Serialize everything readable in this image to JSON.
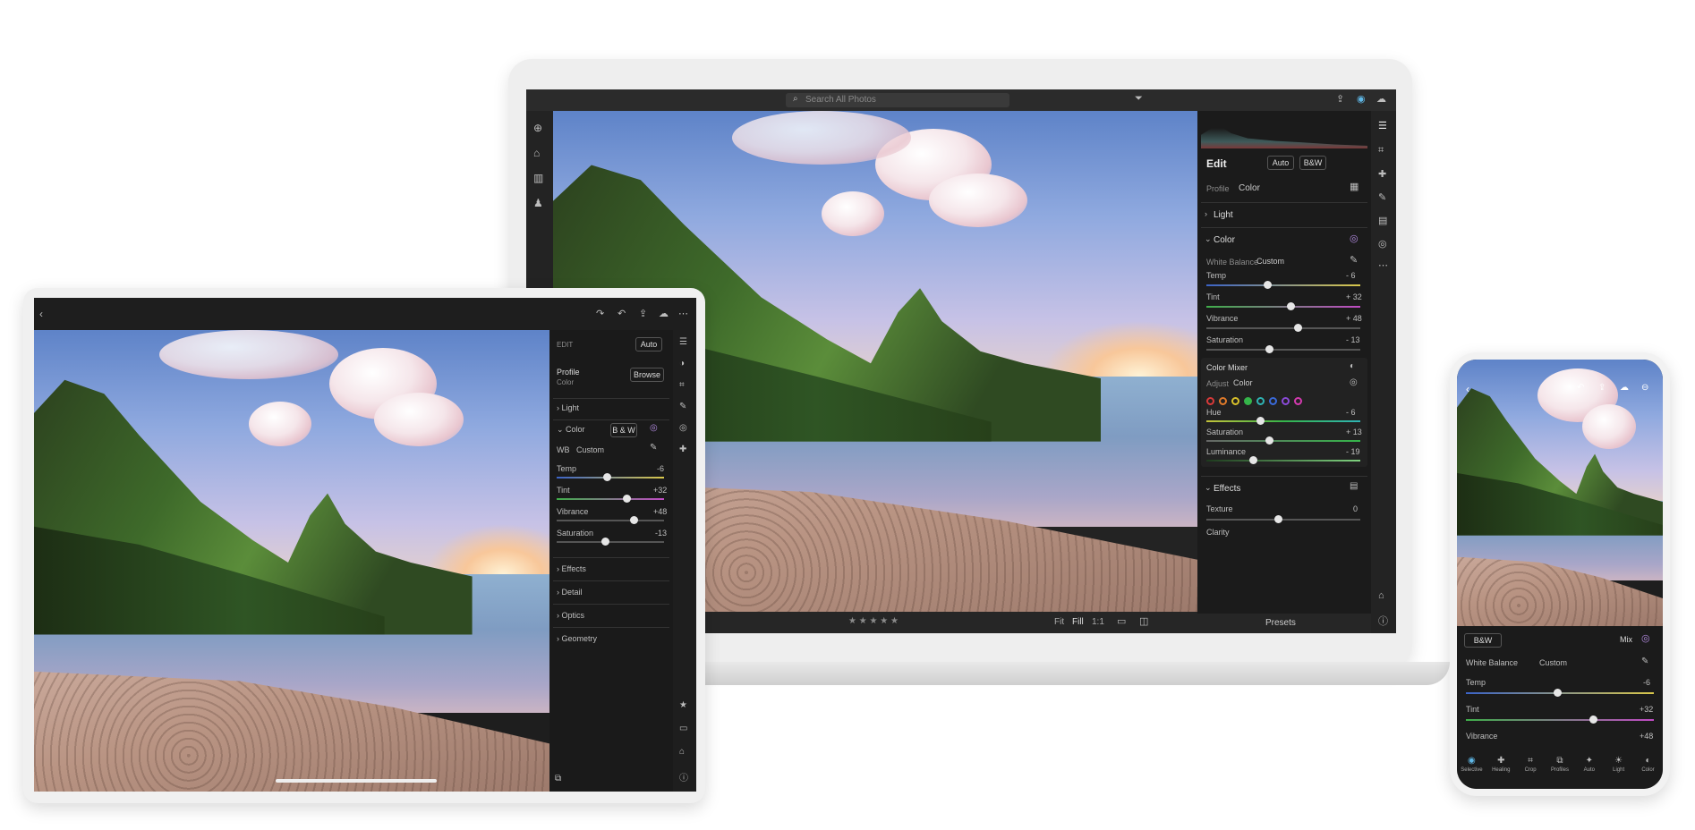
{
  "laptop": {
    "search_placeholder": "Search All Photos",
    "edit_title": "Edit",
    "auto_label": "Auto",
    "bw_label": "B&W",
    "profile_label": "Profile",
    "profile_value": "Color",
    "sections": {
      "light": "Light",
      "color": "Color",
      "effects": "Effects"
    },
    "white_balance_label": "White Balance",
    "white_balance_value": "Custom",
    "sliders": [
      {
        "label": "Temp",
        "value": "- 6"
      },
      {
        "label": "Tint",
        "value": "+ 32"
      },
      {
        "label": "Vibrance",
        "value": "+ 48"
      },
      {
        "label": "Saturation",
        "value": "- 13"
      }
    ],
    "color_mixer": {
      "title": "Color Mixer",
      "adjust_label": "Adjust",
      "adjust_value": "Color",
      "swatches": [
        "#d93a3a",
        "#e07a2a",
        "#d9c12a",
        "#35b54a",
        "#2fb4b4",
        "#3a6ad9",
        "#8b4ad9",
        "#d43ab0"
      ],
      "sliders": [
        {
          "label": "Hue",
          "value": "- 6"
        },
        {
          "label": "Saturation",
          "value": "+ 13"
        },
        {
          "label": "Luminance",
          "value": "- 19"
        }
      ]
    },
    "texture_label": "Texture",
    "texture_value": "0",
    "clarity_label": "Clarity",
    "bottom_bar": {
      "stars": "★ ★ ★ ★ ★",
      "fit": "Fit",
      "fill": "Fill",
      "one_to_one": "1:1",
      "presets": "Presets"
    }
  },
  "tablet": {
    "edit_label": "EDIT",
    "auto_label": "Auto",
    "profile_label": "Profile",
    "profile_value": "Color",
    "browse_label": "Browse",
    "light": "Light",
    "color": "Color",
    "bw_label": "B & W",
    "wb_label": "WB",
    "wb_value": "Custom",
    "sliders": [
      {
        "label": "Temp",
        "value": "-6"
      },
      {
        "label": "Tint",
        "value": "+32"
      },
      {
        "label": "Vibrance",
        "value": "+48"
      },
      {
        "label": "Saturation",
        "value": "-13"
      }
    ],
    "sections": [
      "Effects",
      "Detail",
      "Optics",
      "Geometry"
    ]
  },
  "phone": {
    "bw_label": "B&W",
    "mix_label": "Mix",
    "white_balance_label": "White Balance",
    "white_balance_value": "Custom",
    "sliders": [
      {
        "label": "Temp",
        "value": "-6"
      },
      {
        "label": "Tint",
        "value": "+32"
      },
      {
        "label": "Vibrance",
        "value": "+48"
      }
    ],
    "toolbar": [
      "Selective",
      "Healing",
      "Crop",
      "Profiles",
      "Auto",
      "Light",
      "Color"
    ]
  }
}
